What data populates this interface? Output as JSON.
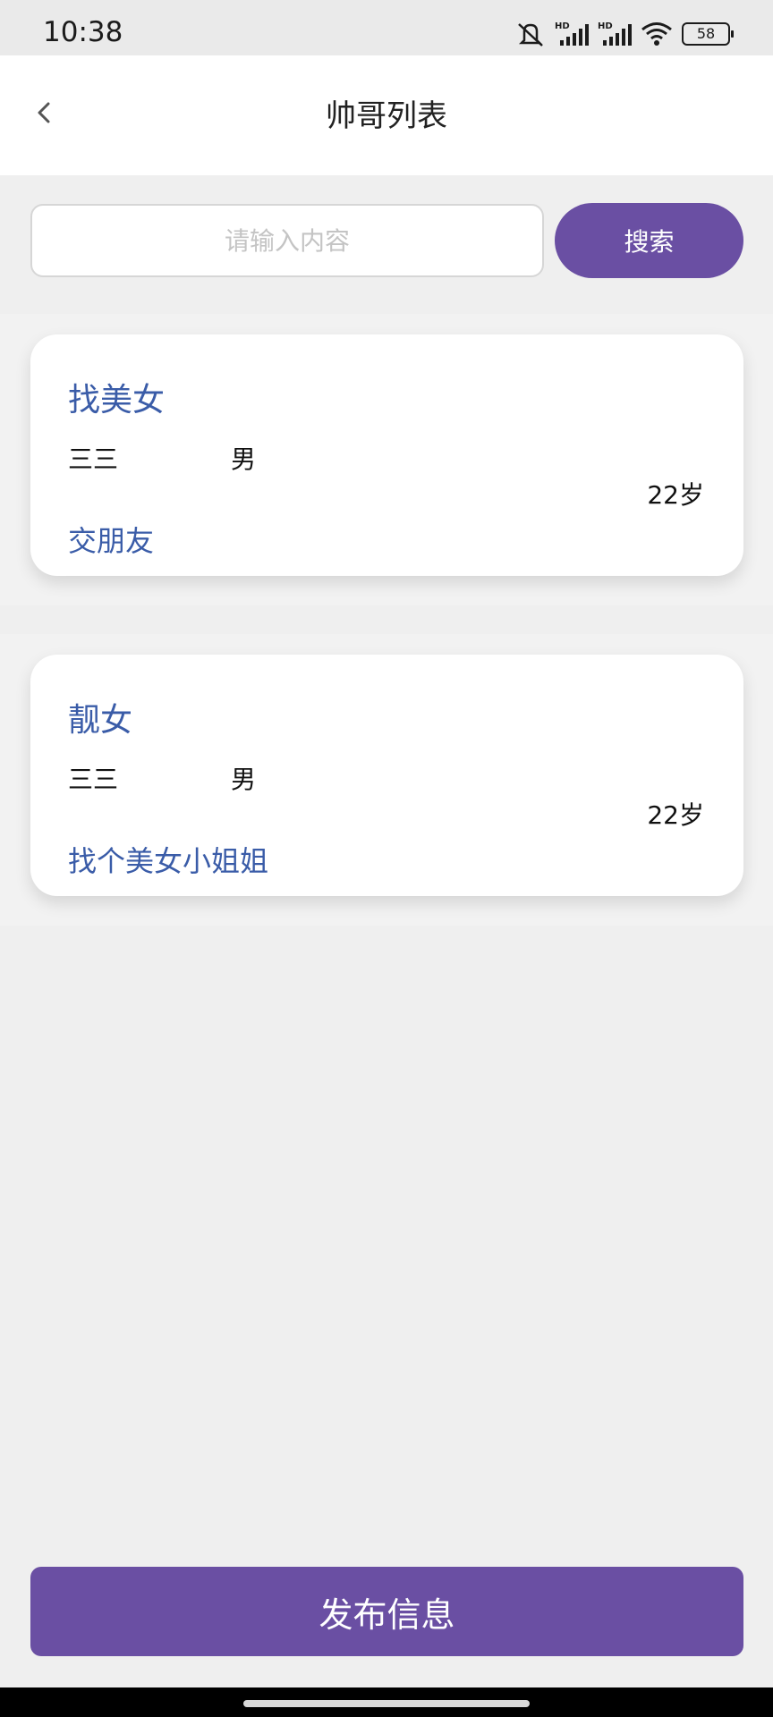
{
  "status_bar": {
    "time": "10:38",
    "icons": [
      "mute-icon",
      "hd-signal-icon",
      "hd-signal-icon",
      "wifi-icon",
      "battery-icon"
    ],
    "battery": "58"
  },
  "header": {
    "back_icon": "chevron-left-icon",
    "title": "帅哥列表"
  },
  "search": {
    "placeholder": "请输入内容",
    "value": "",
    "button_label": "搜索"
  },
  "cards": [
    {
      "title": "找美女",
      "name": "三三",
      "gender": "男",
      "age": "22岁",
      "description": "交朋友"
    },
    {
      "title": "靓女",
      "name": "三三",
      "gender": "男",
      "age": "22岁",
      "description": "找个美女小姐姐"
    }
  ],
  "publish_button": {
    "label": "发布信息"
  },
  "colors": {
    "accent": "#6a4fa3",
    "title_blue": "#3a5ca8",
    "background": "#efefef"
  }
}
